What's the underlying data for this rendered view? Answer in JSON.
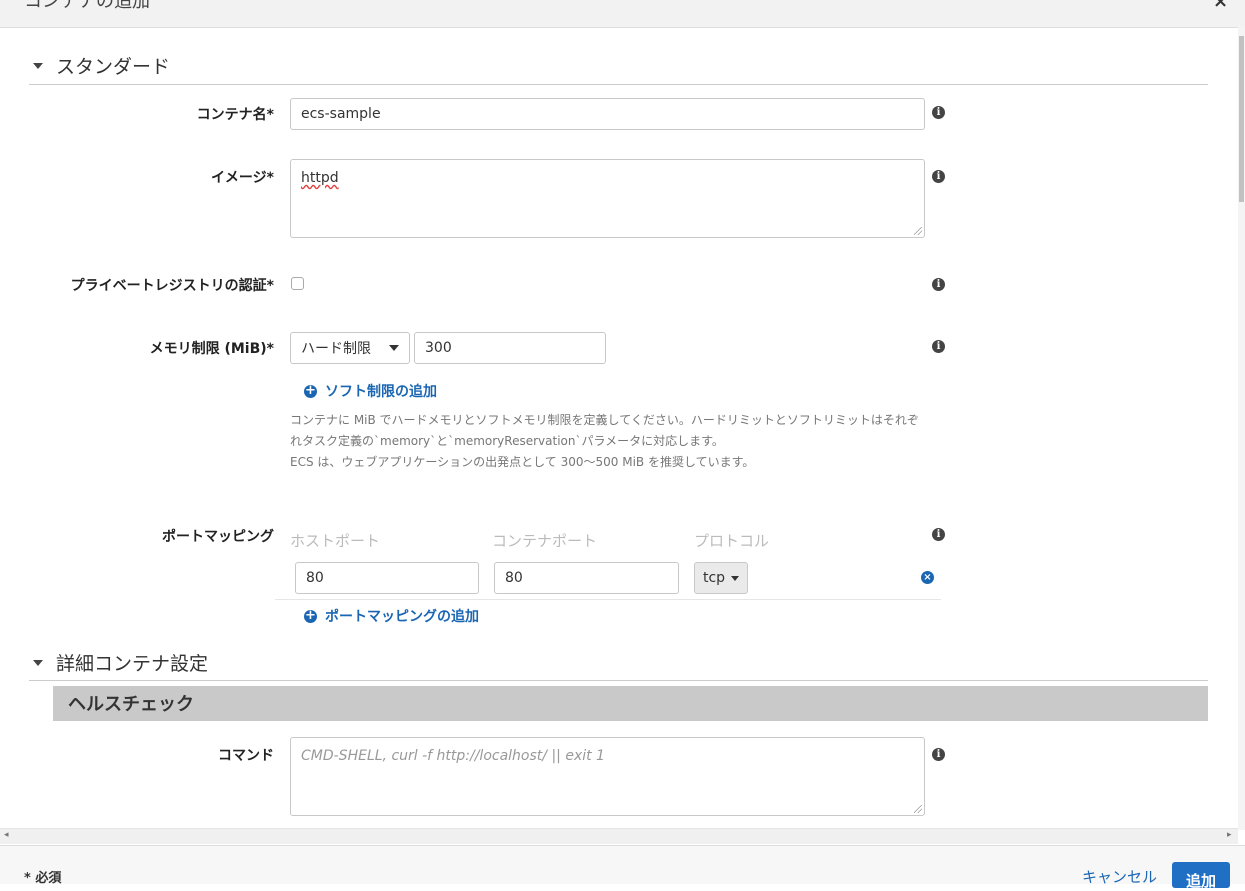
{
  "modal": {
    "title": "コンテナの追加",
    "close_label": "×"
  },
  "standard_section": {
    "title": "スタンダード",
    "container_name": {
      "label": "コンテナ名",
      "required_mark": "*",
      "value": "ecs-sample"
    },
    "image": {
      "label": "イメージ",
      "required_mark": "*",
      "value": "httpd"
    },
    "private_registry": {
      "label": "プライベートレジストリの認証",
      "required_mark": "*",
      "checked": false
    },
    "memory": {
      "label": "メモリ制限 (MiB)",
      "required_mark": "*",
      "limit_type": "ハード制限",
      "value": "300",
      "add_soft_limit": "ソフト制限の追加",
      "help_line1": "コンテナに MiB でハードメモリとソフトメモリ制限を定義してください。ハードリミットとソフトリミットはそれぞ",
      "help_line2": "れタスク定義の`memory`と`memoryReservation`パラメータに対応します。",
      "help_line3": "ECS は、ウェブアプリケーションの出発点として 300〜500 MiB を推奨しています。"
    },
    "port_mapping": {
      "label": "ポートマッピング",
      "col_host": "ホストポート",
      "col_container": "コンテナポート",
      "col_protocol": "プロトコル",
      "host_port": "80",
      "container_port": "80",
      "protocol": "tcp",
      "add_label": "ポートマッピングの追加"
    }
  },
  "advanced_section": {
    "title": "詳細コンテナ設定",
    "healthcheck": {
      "title": "ヘルスチェック",
      "command_label": "コマンド",
      "command_placeholder": "CMD-SHELL, curl -f http://localhost/ || exit 1"
    }
  },
  "footer": {
    "required_note": "* 必須",
    "cancel": "キャンセル",
    "add": "追加"
  },
  "icons": {
    "info": "i",
    "plus": "+",
    "remove": "×"
  },
  "colors": {
    "link": "#1b66b3",
    "primary_button": "#1f6fc5",
    "healthcheck_bar": "#c9c9c9"
  }
}
